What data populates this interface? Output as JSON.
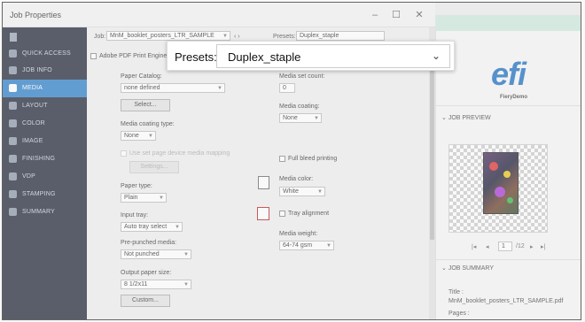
{
  "window": {
    "title": "Job Properties",
    "job_label": "Job:",
    "job_value": "MnM_booklet_posters_LTR_SAMPLE",
    "presets_label": "Presets:",
    "presets_value": "Duplex_staple",
    "adobe_label": "Adobe PDF Print Engine"
  },
  "sidebar": {
    "items": [
      {
        "label": "QUICK ACCESS"
      },
      {
        "label": "JOB INFO"
      },
      {
        "label": "MEDIA"
      },
      {
        "label": "LAYOUT"
      },
      {
        "label": "COLOR"
      },
      {
        "label": "IMAGE"
      },
      {
        "label": "FINISHING"
      },
      {
        "label": "VDP"
      },
      {
        "label": "STAMPING"
      },
      {
        "label": "SUMMARY"
      }
    ]
  },
  "media": {
    "paper_catalog_label": "Paper Catalog:",
    "paper_catalog_value": "none defined",
    "select_button": "Select...",
    "media_coating_type_label": "Media coating type:",
    "media_coating_type_value": "None",
    "use_mapping_label": "Use set page device media mapping",
    "settings_button": "Settings...",
    "paper_type_label": "Paper type:",
    "paper_type_value": "Plain",
    "input_tray_label": "Input tray:",
    "input_tray_value": "Auto tray select",
    "pre_punched_label": "Pre-punched media:",
    "pre_punched_value": "Not punched",
    "output_size_label": "Output paper size:",
    "output_size_value": "8 1/2x11",
    "custom_button": "Custom...",
    "media_set_count_label": "Media set count:",
    "media_set_count_value": "0",
    "media_coating_label": "Media coating:",
    "media_coating_value": "None",
    "full_bleed_label": "Full bleed printing",
    "media_color_label": "Media color:",
    "media_color_value": "White",
    "tray_alignment_label": "Tray alignment",
    "media_weight_label": "Media weight:",
    "media_weight_value": "64-74 gsm"
  },
  "right_panel": {
    "logo": "efi",
    "server_name": "FieryDemo",
    "job_preview_label": "JOB PREVIEW",
    "page_current": "1",
    "page_total": "/12",
    "job_summary_label": "JOB SUMMARY",
    "title_label": "Title :",
    "title_value": "MnM_booklet_posters_LTR_SAMPLE.pdf",
    "pages_label": "Pages :"
  },
  "colors": {
    "accent": "#2f80c8",
    "sidebar_bg": "#22293a",
    "logo": "#1e6fbf"
  }
}
